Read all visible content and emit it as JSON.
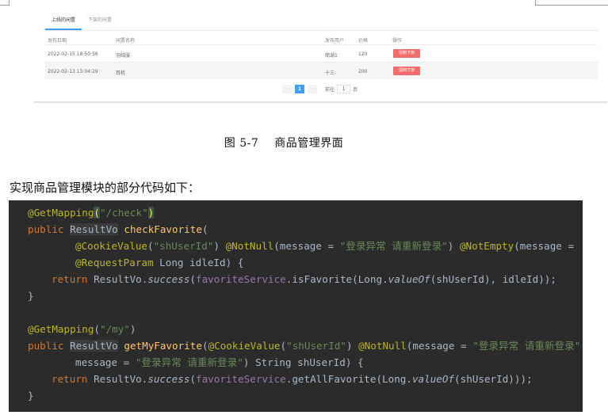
{
  "ui": {
    "tabs": [
      "上线的闲置",
      "下架的闲置"
    ],
    "columns": {
      "date": "发布日期",
      "name": "闲置名称",
      "user": "发布用户",
      "price": "价格",
      "op": "操作"
    },
    "rows": [
      {
        "date": "2022-02-15 18:50:56",
        "name": "羽绒服",
        "user": "简湖1",
        "price": "120",
        "button": "强制下架"
      },
      {
        "date": "2022-02-13 13:04:29",
        "name": "耳机",
        "user": "十三",
        "price": "200",
        "button": "强制下架"
      }
    ],
    "pager": {
      "prev": "‹",
      "page": "1",
      "next": "›",
      "goto_label": "前往",
      "goto_value": "1",
      "page_unit": "页"
    }
  },
  "caption": {
    "number": "图 5-7",
    "title": "商品管理界面"
  },
  "intro": "实现商品管理模块的部分代码如下：",
  "code": {
    "l1_ann": "@GetMapping",
    "l1_open": "(",
    "l1_str": "\"/check\"",
    "l1_close": ")",
    "l2_kw": "public",
    "l2_type": "ResultVo",
    "l2_fn": "checkFavorite",
    "l2_rest": "(",
    "l3_ann1": "@CookieValue",
    "l3_str1": "\"shUserId\"",
    "l3_ann2": "@NotNull",
    "l3_msg1": "message = ",
    "l3_str2": "\"登录异常 请重新登录\"",
    "l3_ann3": "@NotEmpty",
    "l3_msg2": "message =",
    "l4_ann": "@RequestParam",
    "l4_rest": " Long idleId) {",
    "l5_kw": "return",
    "l5_a": " ResultVo.",
    "l5_b": "success",
    "l5_c": "(",
    "l5_d": "favoriteService",
    "l5_e": ".isFavorite(Long.",
    "l5_f": "valueOf",
    "l5_g": "(shUserId), idleId));",
    "l6": "}",
    "l8_ann": "@GetMapping",
    "l8_str": "\"/my\"",
    "l9_kw": "public",
    "l9_type": "ResultVo",
    "l9_fn": "getMyFavorite",
    "l9_ann1": "@CookieValue",
    "l9_str1": "\"shUserId\"",
    "l9_ann2": "@NotNull",
    "l9_msg": "message = ",
    "l9_str2": "\"登录异常 请重新登录\"",
    "l10_msg": "message = ",
    "l10_str": "\"登录异常 请重新登录\"",
    "l10_rest": ") String shUserId) {",
    "l11_kw": "return",
    "l11_a": " ResultVo.",
    "l11_b": "success",
    "l11_c": "(",
    "l11_d": "favoriteService",
    "l11_e": ".getAllFavorite(Long.",
    "l11_f": "valueOf",
    "l11_g": "(shUserId)));",
    "l12": "}"
  },
  "colors": {
    "code_bg": "#2b2b2b",
    "annotation": "#bbb529",
    "keyword": "#cc7832",
    "string": "#6a8759",
    "danger_button": "#f56c6c",
    "primary": "#409eff"
  }
}
